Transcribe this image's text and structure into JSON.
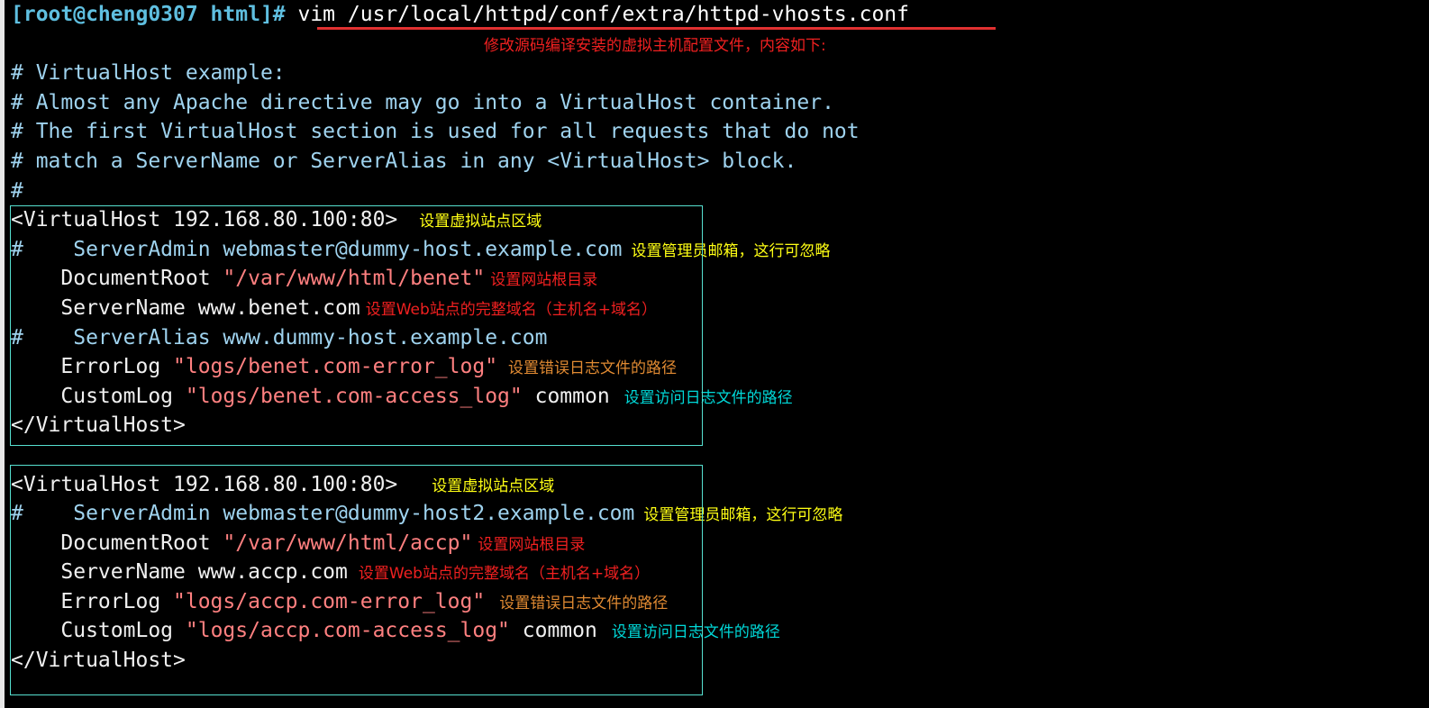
{
  "terminal": {
    "prompt": "[root@cheng0307 html]#",
    "command": " vim /usr/local/httpd/conf/extra/httpd-vhosts.conf",
    "title_annotation": "修改源码编译安装的虚拟主机配置文件，内容如下:"
  },
  "header_comments": [
    "# VirtualHost example:",
    "# Almost any Apache directive may go into a VirtualHost container.",
    "# The first VirtualHost section is used for all requests that do not",
    "# match a ServerName or ServerAlias in any <VirtualHost> block.",
    "#"
  ],
  "vhost1": {
    "open_tag": "<VirtualHost 192.168.80.100:80>",
    "open_tag_annotation": "设置虚拟站点区域",
    "server_admin_line": "#    ServerAdmin webmaster@dummy-host.example.com",
    "server_admin_annotation": "设置管理员邮箱，这行可忽略",
    "document_root_key": "    DocumentRoot ",
    "document_root_value": "\"/var/www/html/benet\"",
    "document_root_annotation": "设置网站根目录",
    "server_name_line": "    ServerName www.benet.com",
    "server_name_annotation": "设置Web站点的完整域名（主机名+域名）",
    "server_alias_line": "#    ServerAlias www.dummy-host.example.com",
    "error_log_key": "    ErrorLog ",
    "error_log_value": "\"logs/benet.com-error_log\"",
    "error_log_annotation": "设置错误日志文件的路径",
    "custom_log_key": "    CustomLog ",
    "custom_log_value": "\"logs/benet.com-access_log\"",
    "custom_log_suffix": " common",
    "custom_log_annotation": "设置访问日志文件的路径",
    "close_tag": "</VirtualHost>"
  },
  "vhost2": {
    "open_tag": "<VirtualHost 192.168.80.100:80>",
    "open_tag_annotation": "设置虚拟站点区域",
    "server_admin_line": "#    ServerAdmin webmaster@dummy-host2.example.com",
    "server_admin_annotation": "设置管理员邮箱，这行可忽略",
    "document_root_key": "    DocumentRoot ",
    "document_root_value": "\"/var/www/html/accp\"",
    "document_root_annotation": "设置网站根目录",
    "server_name_line": "    ServerName www.accp.com",
    "server_name_annotation": "设置Web站点的完整域名（主机名+域名）",
    "error_log_key": "    ErrorLog ",
    "error_log_value": "\"logs/accp.com-error_log\"",
    "error_log_annotation": "设置错误日志文件的路径",
    "custom_log_key": "    CustomLog ",
    "custom_log_value": "\"logs/accp.com-access_log\"",
    "custom_log_suffix": " common",
    "custom_log_annotation": "设置访问日志文件的路径",
    "close_tag": "</VirtualHost>"
  },
  "colors": {
    "background": "#000000",
    "prompt": "#5fbfe0",
    "comment": "#9fd3ef",
    "text": "#f0f0f0",
    "string": "#ff8080",
    "annotation_red": "#f02020",
    "annotation_yellow": "#ffff14",
    "annotation_orange": "#e08a32",
    "annotation_cyan": "#00d8d8",
    "box_border": "#56e0d0",
    "underline": "#e03030"
  }
}
